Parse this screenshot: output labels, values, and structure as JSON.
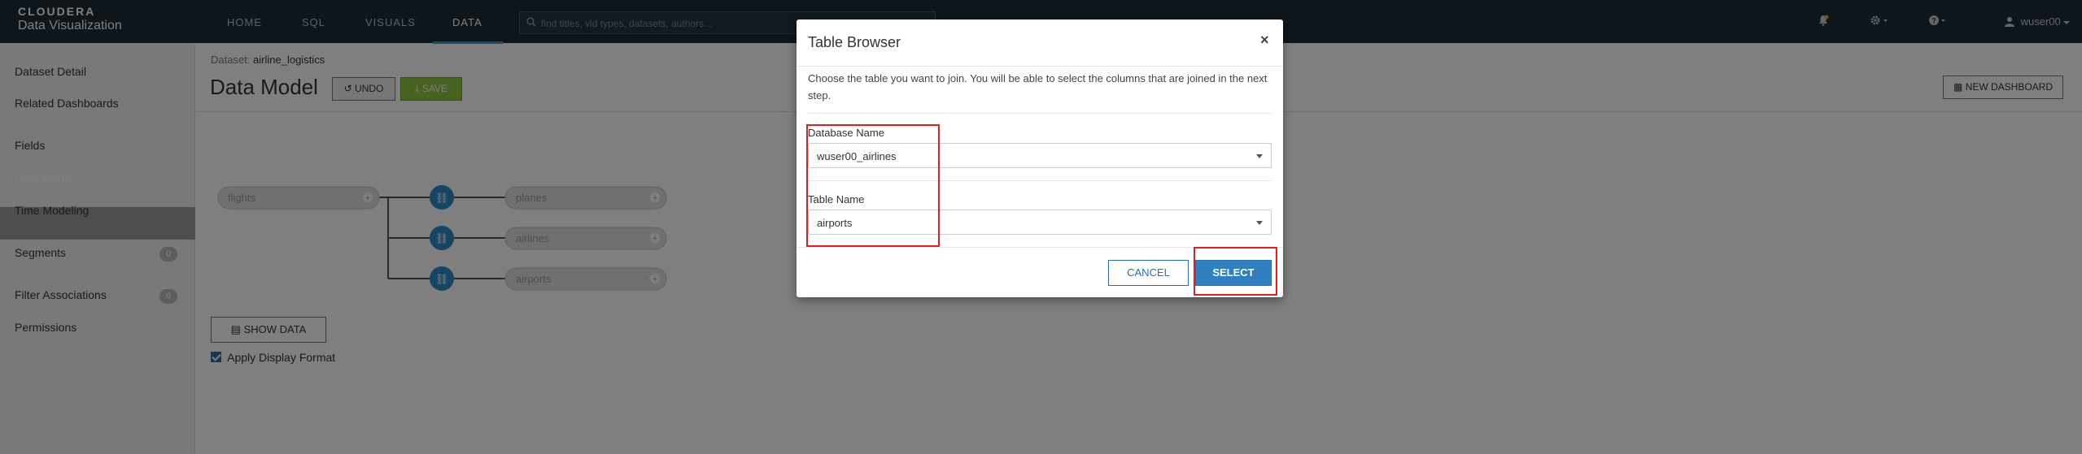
{
  "brand": {
    "line1": "CLOUDERA",
    "line2": "Data Visualization"
  },
  "nav": {
    "tabs": [
      {
        "label": "HOME"
      },
      {
        "label": "SQL"
      },
      {
        "label": "VISUALS"
      },
      {
        "label": "DATA"
      }
    ],
    "active_tab": "DATA",
    "search_placeholder": "find titles, vid types, datasets, authors...",
    "user": "wuser00"
  },
  "sidebar": {
    "items": [
      {
        "label": "Dataset Detail"
      },
      {
        "label": "Related Dashboards"
      },
      {
        "label": "Fields"
      },
      {
        "label": "Data Model"
      },
      {
        "label": "Time Modeling"
      },
      {
        "label": "Segments",
        "badge": "0"
      },
      {
        "label": "Filter Associations",
        "badge": "0"
      },
      {
        "label": "Permissions"
      }
    ],
    "active_item": "Data Model"
  },
  "main": {
    "crumb_label": "Dataset:",
    "crumb_value": "airline_logistics",
    "title": "Data Model",
    "undo_label": "UNDO",
    "save_label": "SAVE",
    "new_dashboard_label": "NEW DASHBOARD",
    "model": {
      "root": "flights",
      "joins": [
        "planes",
        "airlines",
        "airports"
      ]
    },
    "show_data_label": "SHOW DATA",
    "apply_display_format_label": "Apply Display Format",
    "apply_display_format_checked": true
  },
  "modal": {
    "title": "Table Browser",
    "close_glyph": "×",
    "description": "Choose the table you want to join. You will be able to select the columns that are joined in the next step.",
    "database_label": "Database Name",
    "database_value": "wuser00_airlines",
    "table_label": "Table Name",
    "table_value": "airports",
    "cancel_label": "CANCEL",
    "select_label": "SELECT"
  },
  "colors": {
    "nav_bg": "#1d2b36",
    "accent_blue": "#2f7fc1",
    "save_green": "#8cc63f",
    "join_node": "#2c8ac9",
    "highlight_red": "#e02020"
  }
}
